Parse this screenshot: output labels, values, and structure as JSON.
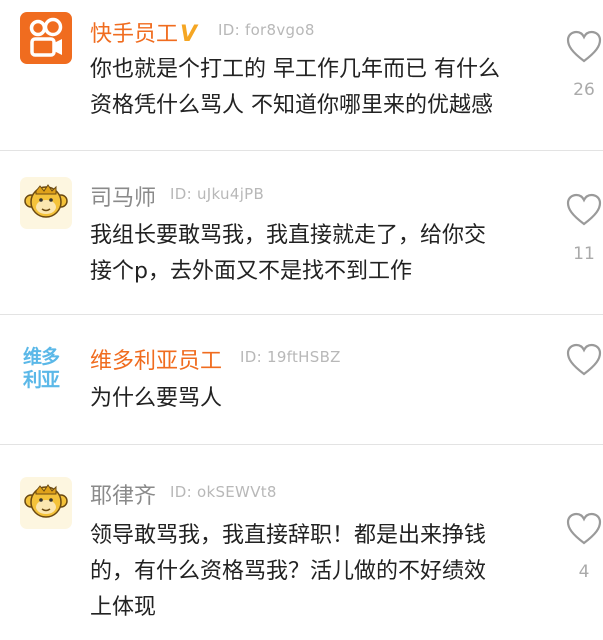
{
  "colors": {
    "accent": "#f06c1f",
    "badge": "#f5a623",
    "name_gray": "#8a8a8a",
    "id_gray": "#b8b8b8",
    "divider": "#e3e3e3"
  },
  "comments": [
    {
      "author": "快手员工",
      "badge": "V",
      "user_id": "ID: for8vgo8",
      "lines": [
        "你也就是个打工的 早工作几年而已 有什么",
        "资格凭什么骂人 不知道你哪里来的优越感"
      ],
      "likes": "26",
      "avatar_icon": "kuaishou-logo-icon"
    },
    {
      "author": "司马师",
      "user_id": "ID: uJku4jPB",
      "lines": [
        "我组长要敢骂我，我直接就走了，给你交",
        "接个p，去外面又不是找不到工作"
      ],
      "likes": "11",
      "avatar_icon": "monkey-avatar-icon"
    },
    {
      "author": "维多利亚员工",
      "user_id": "ID: 19ftHSBZ",
      "lines": [
        "为什么要骂人"
      ],
      "likes": "",
      "avatar_text": [
        "维多",
        "利亚"
      ]
    },
    {
      "author": "耶律齐",
      "user_id": "ID: okSEWVt8",
      "lines": [
        "领导敢骂我，我直接辞职！都是出来挣钱",
        "的，有什么资格骂我？活儿做的不好绩效",
        "上体现"
      ],
      "likes": "4",
      "avatar_icon": "monkey-avatar-icon"
    }
  ]
}
